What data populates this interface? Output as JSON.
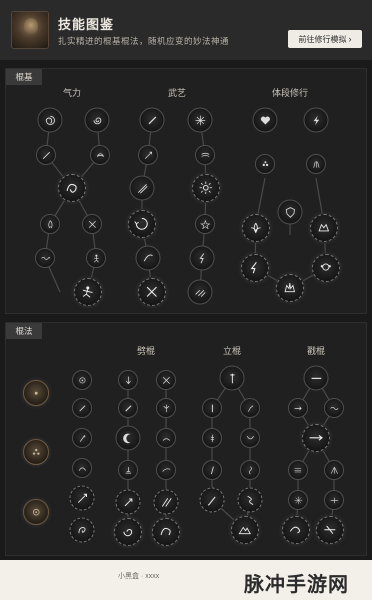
{
  "header": {
    "title": "技能图鉴",
    "subtitle": "扎实精进的棍基棍法，随机应变的妙法神通",
    "preview_button": "前往修行模拟",
    "preview_chevron": "›"
  },
  "panels": {
    "gunji": {
      "tag": "棍基",
      "groups": [
        "气力",
        "武艺",
        "体段修行"
      ]
    },
    "gunfa": {
      "tag": "棍法",
      "groups": [
        "劈棍",
        "立棍",
        "戳棍"
      ]
    }
  },
  "watermark": {
    "text": "小黑盒  ·  xxxx",
    "site": "脉冲手游网"
  },
  "colors": {
    "background": "#1a1a1a",
    "panel": "#202020",
    "node_border": "#4f4f4f",
    "accent_button": "#efece6"
  }
}
